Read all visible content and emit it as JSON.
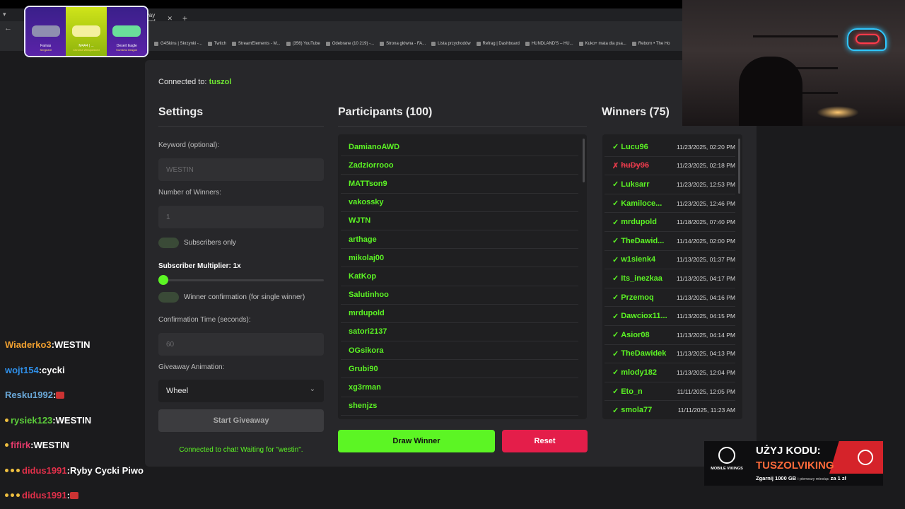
{
  "browser": {
    "tab_title": "way Tool",
    "tab_close": "✕",
    "new_tab": "+",
    "win_menu": "▾",
    "nav_back": "←",
    "bookmarks": [
      "G4Skins | Skrzynki -...",
      "Twitch",
      "StreamElements - M...",
      "(356) YouTube",
      "Odebrane (10 219) -...",
      "Strona główna - FA...",
      "Lista przychodów",
      "Refrag | Dashboard",
      "HUNDLAND'S – HU...",
      "Kuko+ mata dla psa...",
      "Reborn • The Ho"
    ]
  },
  "overlay_card": {
    "skins": [
      {
        "name": "Famas",
        "sub": "Sergeant"
      },
      {
        "name": "M4A4 | ...",
        "sub": "Chroma Weaponized"
      },
      {
        "name": "Desert Eagle",
        "sub": "Kumicho Dragon"
      }
    ]
  },
  "chat": [
    {
      "user": "Wiaderko3",
      "user_color": "#f0a030",
      "text": "WESTIN",
      "badges": 0,
      "emote": false
    },
    {
      "user": "wojt154",
      "user_color": "#2f8fe8",
      "text": "cycki",
      "badges": 0,
      "emote": false
    },
    {
      "user": "Resku1992",
      "user_color": "#6aa8d8",
      "text": "",
      "badges": 0,
      "emote": true
    },
    {
      "user": "rysiek123",
      "user_color": "#5ccf3a",
      "text": "WESTIN",
      "badges": 1,
      "emote": false
    },
    {
      "user": "fifirk",
      "user_color": "#e23a6a",
      "text": "WESTIN",
      "badges": 1,
      "emote": false
    },
    {
      "user": "didus1991",
      "user_color": "#e2304a",
      "text": "Ryby Cycki Piwo",
      "badges": 3,
      "emote": false
    },
    {
      "user": "didus1991",
      "user_color": "#e2304a",
      "text": "",
      "badges": 3,
      "emote": true
    }
  ],
  "app": {
    "connected_prefix": "Connected to:",
    "connected_channel": "tuszol",
    "settings": {
      "title": "Settings",
      "keyword_label": "Keyword (optional):",
      "keyword_placeholder": "WESTIN",
      "winners_label": "Number of Winners:",
      "winners_placeholder": "1",
      "subs_only_label": "Subscribers only",
      "subs_only_on": false,
      "multiplier_label": "Subscriber Multiplier: 1x",
      "multiplier_value": 1,
      "confirmation_label": "Winner confirmation (for single winner)",
      "confirmation_on": false,
      "confirm_time_label": "Confirmation Time (seconds):",
      "confirm_time_placeholder": "60",
      "animation_label": "Giveaway Animation:",
      "animation_value": "Wheel",
      "animation_chevron": "⌄",
      "start_button": "Start Giveaway",
      "status_text": "Connected to chat! Waiting for \"westin\"."
    },
    "participants": {
      "title": "Participants (100)",
      "names": [
        "DamianoAWD",
        "Zadziorrooo",
        "MATTson9",
        "vakossky",
        "WJTN",
        "arthage",
        "mikolaj00",
        "KatKop",
        "Salutinhoo",
        "mrdupold",
        "satori2137",
        "OGsikora",
        "Grubi90",
        "xg3rman",
        "shenjzs"
      ]
    },
    "draw_button": "Draw Winner",
    "reset_button": "Reset",
    "winners": {
      "title": "Winners (75)",
      "rows": [
        {
          "mark": "✓",
          "name": "Lucu96",
          "date": "11/23/2025, 02:20 PM",
          "rejected": false
        },
        {
          "mark": "✗",
          "name": "huDy96",
          "date": "11/23/2025, 02:18 PM",
          "rejected": true
        },
        {
          "mark": "✓",
          "name": "Luksarr",
          "date": "11/23/2025, 12:53 PM",
          "rejected": false
        },
        {
          "mark": "✓",
          "name": "Kamiloce...",
          "date": "11/23/2025, 12:46 PM",
          "rejected": false
        },
        {
          "mark": "✓",
          "name": "mrdupold",
          "date": "11/18/2025, 07:40 PM",
          "rejected": false
        },
        {
          "mark": "✓",
          "name": "TheDawid...",
          "date": "11/14/2025, 02:00 PM",
          "rejected": false
        },
        {
          "mark": "✓",
          "name": "w1sienk4",
          "date": "11/13/2025, 01:37 PM",
          "rejected": false
        },
        {
          "mark": "✓",
          "name": "Its_inezkaa",
          "date": "11/13/2025, 04:17 PM",
          "rejected": false
        },
        {
          "mark": "✓",
          "name": "Przemoq",
          "date": "11/13/2025, 04:16 PM",
          "rejected": false
        },
        {
          "mark": "✓",
          "name": "Dawciox11...",
          "date": "11/13/2025, 04:15 PM",
          "rejected": false
        },
        {
          "mark": "✓",
          "name": "Asior08",
          "date": "11/13/2025, 04:14 PM",
          "rejected": false
        },
        {
          "mark": "✓",
          "name": "TheDawidek",
          "date": "11/13/2025, 04:13 PM",
          "rejected": false
        },
        {
          "mark": "✓",
          "name": "mlody182",
          "date": "11/13/2025, 12:04 PM",
          "rejected": false
        },
        {
          "mark": "✓",
          "name": "Eto_n",
          "date": "11/11/2025, 12:05 PM",
          "rejected": false
        },
        {
          "mark": "✓",
          "name": "smola77",
          "date": "11/11/2025, 11:23 AM",
          "rejected": false
        }
      ]
    }
  },
  "ad": {
    "logo_text": "MOBILE VIKINGS",
    "headline": "UŻYJ KODU:",
    "code": "TUSZOLVIKING",
    "promo_main": "Zgarnij 1000 GB",
    "promo_small": "i pierwszy miesiąc",
    "promo_end": "za 1 zł"
  },
  "colors": {
    "accent_green": "#5cf524",
    "danger_red": "#e41e4a",
    "panel_bg": "#27272a"
  }
}
